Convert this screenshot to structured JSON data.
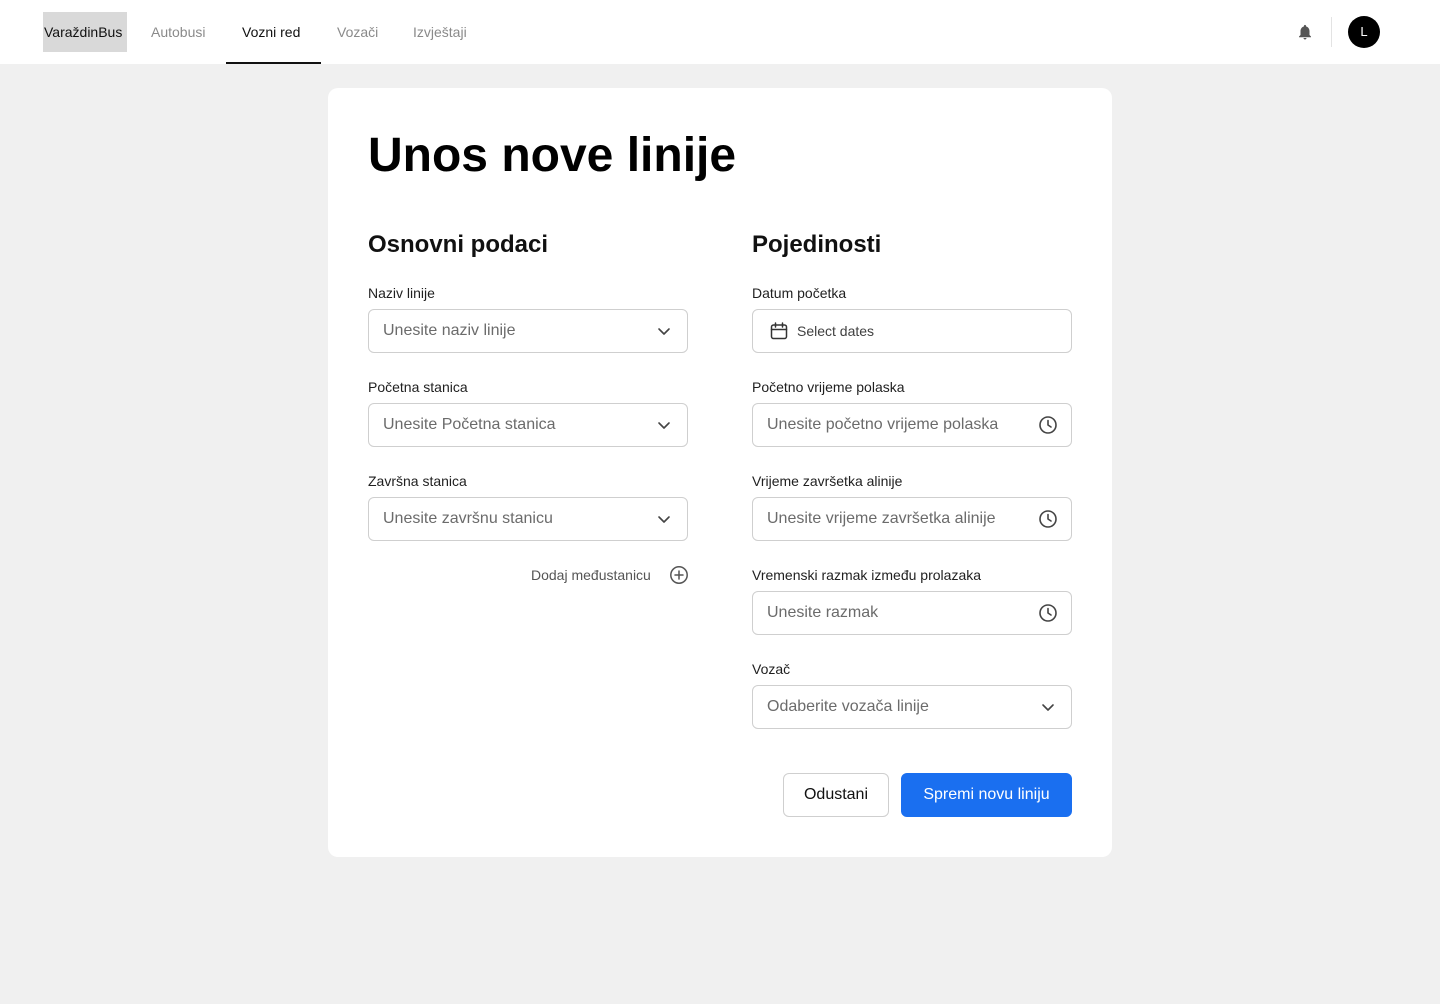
{
  "header": {
    "brand": "VaraždinBus",
    "nav": [
      {
        "label": "Autobusi"
      },
      {
        "label": "Vozni red"
      },
      {
        "label": "Vozači"
      },
      {
        "label": "Izvještaji"
      }
    ],
    "active_nav": "Vozni red",
    "avatar_initial": "L"
  },
  "page": {
    "title": "Unos nove linije"
  },
  "basic": {
    "heading": "Osnovni podaci",
    "line_name": {
      "label": "Naziv linije",
      "placeholder": "Unesite naziv linije"
    },
    "start_station": {
      "label": "Početna stanica",
      "placeholder": "Unesite Početna stanica"
    },
    "end_station": {
      "label": "Završna stanica",
      "placeholder": "Unesite završnu stanicu"
    },
    "add_stop_label": "Dodaj međustanicu"
  },
  "details": {
    "heading": "Pojedinosti",
    "start_date": {
      "label": "Datum početka",
      "placeholder": "Select dates"
    },
    "start_time": {
      "label": "Početno vrijeme polaska",
      "placeholder": "Unesite početno vrijeme polaska"
    },
    "end_time": {
      "label": "Vrijeme završetka alinije",
      "placeholder": "Unesite vrijeme završetka alinije"
    },
    "interval": {
      "label": "Vremenski razmak između prolazaka",
      "placeholder": "Unesite razmak"
    },
    "driver": {
      "label": "Vozač",
      "placeholder": "Odaberite vozača linije"
    }
  },
  "actions": {
    "cancel": "Odustani",
    "save": "Spremi novu liniju"
  },
  "colors": {
    "primary": "#1a6ff0",
    "background": "#f0f0f0",
    "card": "#ffffff"
  },
  "icons": {
    "bell": "bell-icon",
    "chevron": "chevron-down-icon",
    "clock": "clock-icon",
    "calendar": "calendar-icon",
    "add": "plus-circle-icon"
  }
}
